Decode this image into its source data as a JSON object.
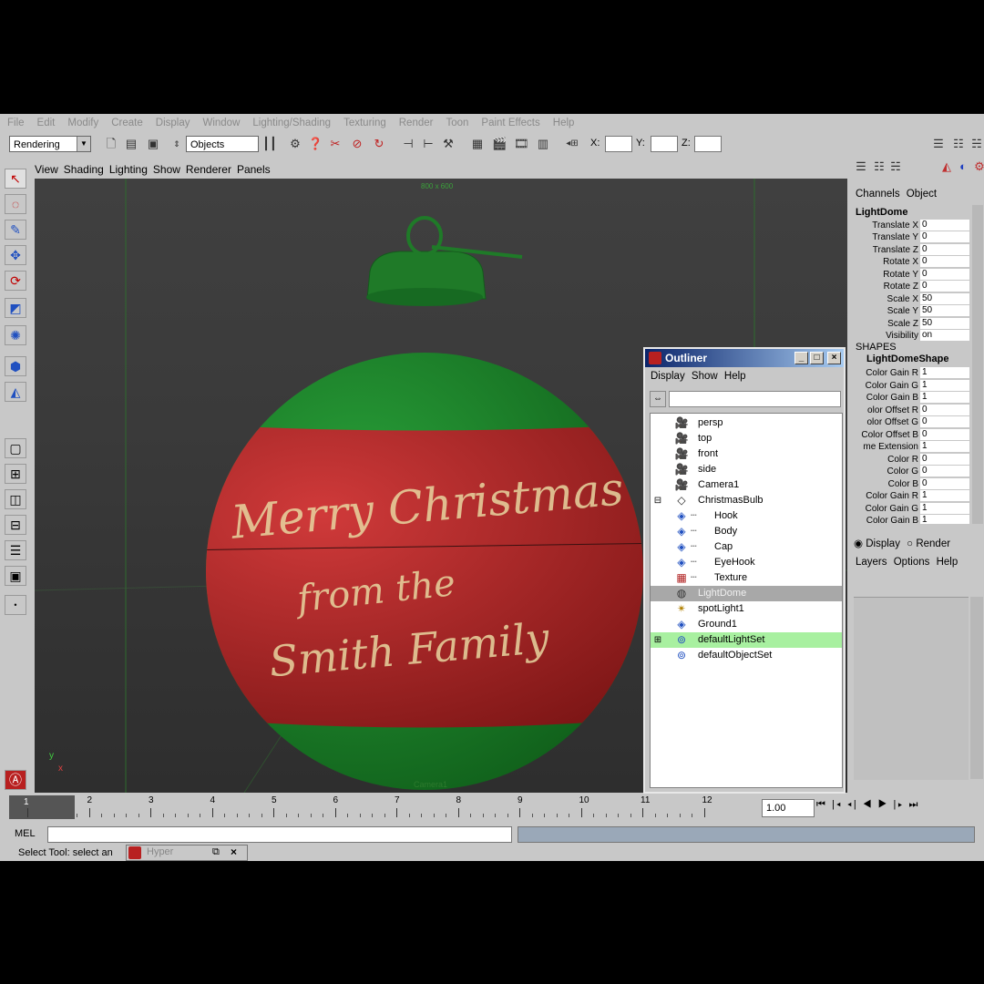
{
  "menubar": [
    "File",
    "Edit",
    "Modify",
    "Create",
    "Display",
    "Window",
    "Lighting/Shading",
    "Texturing",
    "Render",
    "Toon",
    "Paint Effects",
    "Help"
  ],
  "toolbar": {
    "menuset": "Rendering",
    "selmode": "Objects",
    "x_label": "X:",
    "y_label": "Y:",
    "z_label": "Z:"
  },
  "viewport": {
    "menu": [
      "View",
      "Shading",
      "Lighting",
      "Show",
      "Renderer",
      "Panels"
    ],
    "resolution": "800 x 600",
    "camera": "Camera1",
    "axis_y": "y",
    "axis_x": "x",
    "ornament_text_1": "Merry Christmas",
    "ornament_text_2": "from the",
    "ornament_text_3": "Smith Family",
    "colors": {
      "green": "#1f8a2a",
      "red": "#b02a2a",
      "text": "#e8d6a0"
    }
  },
  "channelbox": {
    "tabs": [
      "Channels",
      "Object"
    ],
    "node": "LightDome",
    "attrs": [
      {
        "label": "Translate X",
        "value": "0"
      },
      {
        "label": "Translate Y",
        "value": "0"
      },
      {
        "label": "Translate Z",
        "value": "0"
      },
      {
        "label": "Rotate X",
        "value": "0"
      },
      {
        "label": "Rotate Y",
        "value": "0"
      },
      {
        "label": "Rotate Z",
        "value": "0"
      },
      {
        "label": "Scale X",
        "value": "50"
      },
      {
        "label": "Scale Y",
        "value": "50"
      },
      {
        "label": "Scale Z",
        "value": "50"
      },
      {
        "label": "Visibility",
        "value": "on"
      }
    ],
    "shapes_header": "SHAPES",
    "shape_node": "LightDomeShape",
    "shape_attrs": [
      {
        "label": "Color Gain R",
        "value": "1"
      },
      {
        "label": "Color Gain G",
        "value": "1"
      },
      {
        "label": "Color Gain B",
        "value": "1"
      },
      {
        "label": "olor Offset R",
        "value": "0"
      },
      {
        "label": "olor Offset G",
        "value": "0"
      },
      {
        "label": "Color Offset B",
        "value": "0"
      },
      {
        "label": "me Extension",
        "value": "1"
      },
      {
        "label": "Color R",
        "value": "0"
      },
      {
        "label": "Color G",
        "value": "0"
      },
      {
        "label": "Color B",
        "value": "0"
      },
      {
        "label": "Color Gain R",
        "value": "1"
      },
      {
        "label": "Color Gain G",
        "value": "1"
      },
      {
        "label": "Color Gain B",
        "value": "1"
      }
    ],
    "display_radio": "Display",
    "render_radio": "Render",
    "layer_menu": [
      "Layers",
      "Options",
      "Help"
    ]
  },
  "outliner": {
    "title": "Outliner",
    "menu": [
      "Display",
      "Show",
      "Help"
    ],
    "items": [
      {
        "label": "persp",
        "indent": 0,
        "icon": "camera-icon"
      },
      {
        "label": "top",
        "indent": 0,
        "icon": "camera-icon"
      },
      {
        "label": "front",
        "indent": 0,
        "icon": "camera-icon"
      },
      {
        "label": "side",
        "indent": 0,
        "icon": "camera-icon"
      },
      {
        "label": "Camera1",
        "indent": 0,
        "icon": "camera-icon"
      },
      {
        "label": "ChristmasBulb",
        "indent": 0,
        "icon": "group-icon",
        "expand": "⊟"
      },
      {
        "label": "Hook",
        "indent": 1,
        "icon": "mesh-icon"
      },
      {
        "label": "Body",
        "indent": 1,
        "icon": "mesh-icon"
      },
      {
        "label": "Cap",
        "indent": 1,
        "icon": "mesh-icon"
      },
      {
        "label": "EyeHook",
        "indent": 1,
        "icon": "mesh-icon"
      },
      {
        "label": "Texture",
        "indent": 1,
        "icon": "texture-icon"
      },
      {
        "label": "LightDome",
        "indent": 0,
        "icon": "lightdome-icon",
        "selected": true
      },
      {
        "label": "spotLight1",
        "indent": 0,
        "icon": "spotlight-icon"
      },
      {
        "label": "Ground1",
        "indent": 0,
        "icon": "mesh-icon"
      },
      {
        "label": "defaultLightSet",
        "indent": 0,
        "icon": "set-icon",
        "expand": "⊞",
        "highlight": true
      },
      {
        "label": "defaultObjectSet",
        "indent": 0,
        "icon": "set-icon"
      }
    ]
  },
  "timeline": {
    "ticks": [
      "1",
      "2",
      "3",
      "4",
      "5",
      "6",
      "7",
      "8",
      "9",
      "10",
      "11",
      "12"
    ],
    "current_time": "1.00"
  },
  "cmdline": {
    "label": "MEL"
  },
  "helpline": {
    "text": "Select Tool: select an",
    "task_label": "Hyper"
  }
}
